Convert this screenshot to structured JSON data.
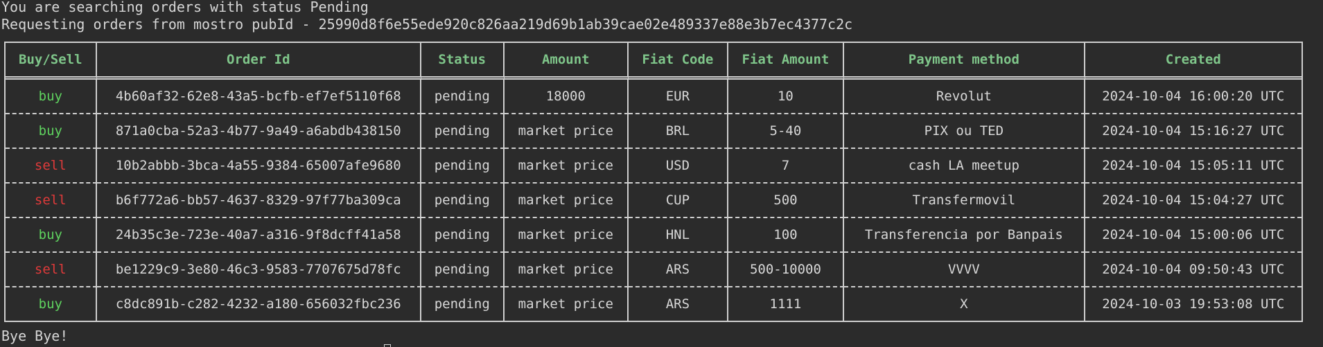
{
  "terminal": {
    "line1": "You are searching orders with status Pending",
    "line2": "Requesting orders from mostro pubId - 25990d8f6e55ede920c826aa219d69b1ab39cae02e489337e88e3b7ec4377c2c",
    "footer": "Bye Bye!"
  },
  "colors": {
    "background": "#2b2b2b",
    "header": "#7fc68a",
    "buy": "#5fd35f",
    "sell": "#e03a3a"
  },
  "table": {
    "headers": [
      "Buy/Sell",
      "Order Id",
      "Status",
      "Amount",
      "Fiat Code",
      "Fiat Amount",
      "Payment method",
      "Created"
    ],
    "rows": [
      {
        "kind": "buy",
        "order_id": "4b60af32-62e8-43a5-bcfb-ef7ef5110f68",
        "status": "pending",
        "amount": "18000",
        "fiat_code": "EUR",
        "fiat_amount": "10",
        "payment": "Revolut",
        "created": "2024-10-04 16:00:20 UTC"
      },
      {
        "kind": "buy",
        "order_id": "871a0cba-52a3-4b77-9a49-a6abdb438150",
        "status": "pending",
        "amount": "market price",
        "fiat_code": "BRL",
        "fiat_amount": "5-40",
        "payment": "PIX ou TED",
        "created": "2024-10-04 15:16:27 UTC"
      },
      {
        "kind": "sell",
        "order_id": "10b2abbb-3bca-4a55-9384-65007afe9680",
        "status": "pending",
        "amount": "market price",
        "fiat_code": "USD",
        "fiat_amount": "7",
        "payment": "cash LA meetup",
        "created": "2024-10-04 15:05:11 UTC"
      },
      {
        "kind": "sell",
        "order_id": "b6f772a6-bb57-4637-8329-97f77ba309ca",
        "status": "pending",
        "amount": "market price",
        "fiat_code": "CUP",
        "fiat_amount": "500",
        "payment": "Transfermovil",
        "created": "2024-10-04 15:04:27 UTC"
      },
      {
        "kind": "buy",
        "order_id": "24b35c3e-723e-40a7-a316-9f8dcff41a58",
        "status": "pending",
        "amount": "market price",
        "fiat_code": "HNL",
        "fiat_amount": "100",
        "payment": "Transferencia por Banpais",
        "created": "2024-10-04 15:00:06 UTC"
      },
      {
        "kind": "sell",
        "order_id": "be1229c9-3e80-46c3-9583-7707675d78fc",
        "status": "pending",
        "amount": "market price",
        "fiat_code": "ARS",
        "fiat_amount": "500-10000",
        "payment": "VVVV",
        "created": "2024-10-04 09:50:43 UTC"
      },
      {
        "kind": "buy",
        "order_id": "c8dc891b-c282-4232-a180-656032fbc236",
        "status": "pending",
        "amount": "market price",
        "fiat_code": "ARS",
        "fiat_amount": "1111",
        "payment": "X",
        "created": "2024-10-03 19:53:08 UTC"
      }
    ]
  }
}
